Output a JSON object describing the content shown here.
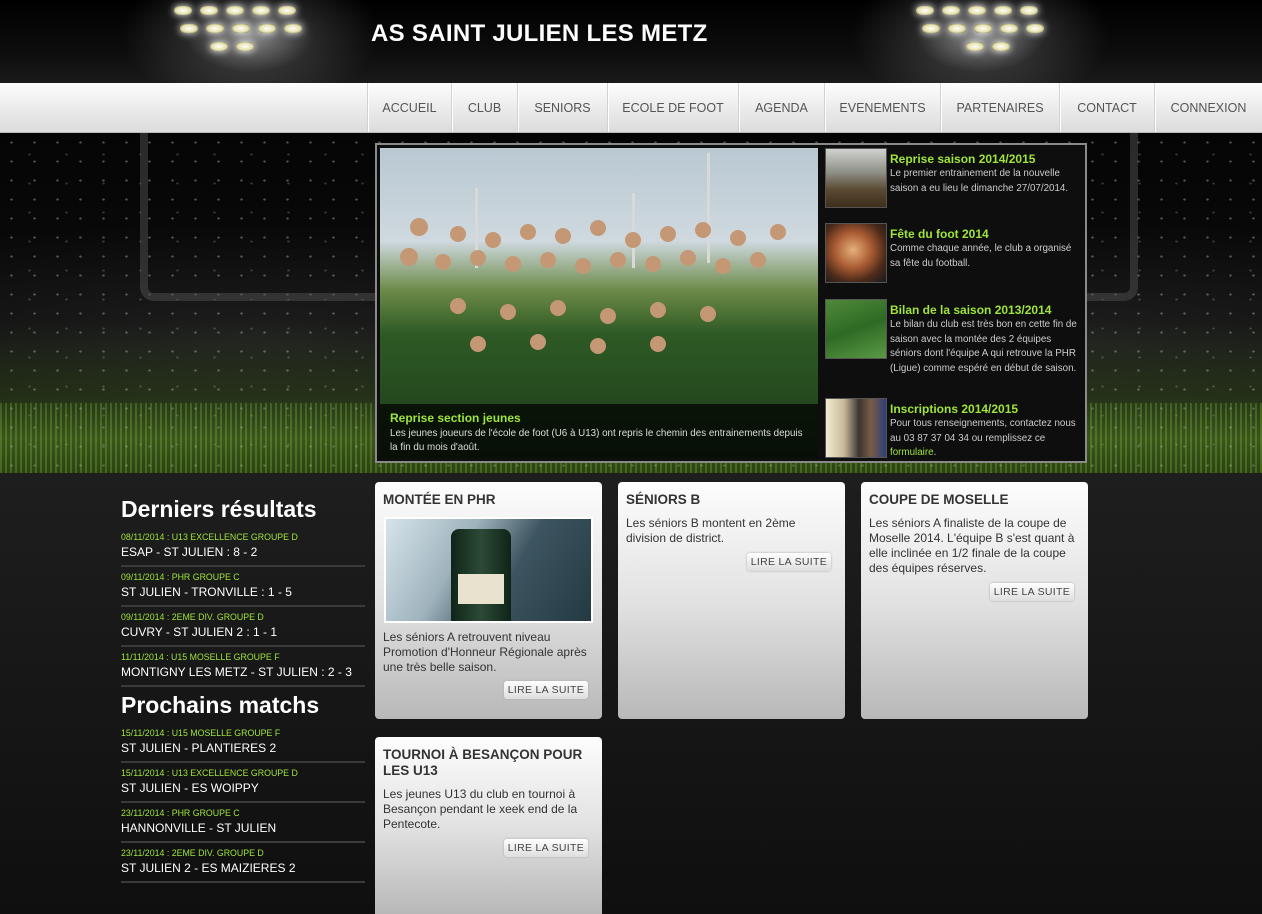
{
  "site": {
    "title": "AS SAINT JULIEN LES METZ"
  },
  "nav": {
    "items": [
      "ACCUEIL",
      "CLUB",
      "SENIORS",
      "ECOLE DE FOOT",
      "AGENDA",
      "EVENEMENTS",
      "PARTENAIRES",
      "CONTACT",
      "CONNEXION"
    ]
  },
  "slider": {
    "main": {
      "title": "Reprise section jeunes",
      "desc": "Les jeunes joueurs de l'école de foot (U6 à U13) ont repris le chemin des entrainements depuis la fin du mois d'août."
    },
    "items": [
      {
        "title": "Reprise saison 2014/2015",
        "desc": "Le premier entrainement de la nouvelle saison a eu lieu le dimanche 27/07/2014."
      },
      {
        "title": "Fête du foot 2014",
        "desc": "Comme chaque année, le club a organisé sa fête du football."
      },
      {
        "title": "Bilan de la saison 2013/2014",
        "desc": "Le bilan du club est très bon en cette fin de saison avec la montée des 2 équipes séniors dont l'équipe A qui retrouve la PHR (Ligue) comme espéré en début de saison."
      },
      {
        "title": "Inscriptions 2014/2015",
        "desc": "Pour tous renseignements, contactez nous au 03 87 37 04 34 ou remplissez ce",
        "link": "formulaire",
        "end": "."
      }
    ]
  },
  "results": {
    "heading": "Derniers résultats",
    "items": [
      {
        "meta": "08/11/2014 : U13 EXCELLENCE GROUPE D",
        "score": "ESAP - ST JULIEN : 8 - 2"
      },
      {
        "meta": "09/11/2014 : PHR GROUPE C",
        "score": "ST JULIEN - TRONVILLE : 1 - 5"
      },
      {
        "meta": "09/11/2014 : 2EME DIV. GROUPE D",
        "score": "CUVRY - ST JULIEN 2 : 1 - 1"
      },
      {
        "meta": "11/11/2014 : U15 MOSELLE GROUPE F",
        "score": "MONTIGNY LES METZ - ST JULIEN : 2 - 3"
      }
    ]
  },
  "upcoming": {
    "heading": "Prochains matchs",
    "items": [
      {
        "meta": "15/11/2014 : U15 MOSELLE GROUPE F",
        "score": "ST JULIEN - PLANTIERES 2"
      },
      {
        "meta": "15/11/2014 : U13 EXCELLENCE GROUPE D",
        "score": "ST JULIEN - ES WOIPPY"
      },
      {
        "meta": "23/11/2014 : PHR GROUPE C",
        "score": "HANNONVILLE - ST JULIEN"
      },
      {
        "meta": "23/11/2014 : 2EME DIV. GROUPE D",
        "score": "ST JULIEN 2 - ES MAIZIERES 2"
      }
    ]
  },
  "articles": [
    {
      "title": "MONTÉE EN PHR",
      "text": "Les séniors A retrouvent niveau Promotion d'Honneur Régionale après une très belle saison.",
      "button": "LIRE LA SUITE"
    },
    {
      "title": "SÉNIORS B",
      "text": "Les séniors B montent en 2ème division de district.",
      "button": "LIRE LA SUITE"
    },
    {
      "title": "COUPE DE MOSELLE",
      "text": "Les séniors A finaliste de la coupe de Moselle 2014. L'équipe B s'est quant à elle inclinée en 1/2 finale de la coupe des équipes réserves.",
      "button": "LIRE LA SUITE"
    },
    {
      "title": "TOURNOI À BESANÇON POUR LES U13",
      "text": "Les jeunes U13 du club en tournoi à Besançon pendant le xeek end de la Pentecote.",
      "button": "LIRE LA SUITE"
    }
  ]
}
